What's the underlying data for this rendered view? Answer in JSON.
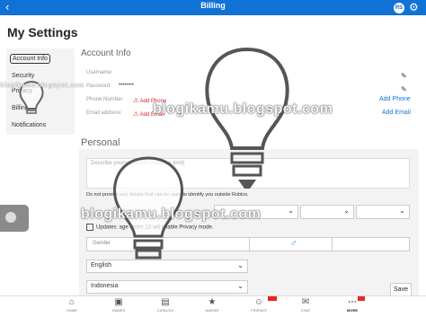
{
  "topbar": {
    "title": "Billing",
    "back_icon": "back-arrow-icon",
    "robux_label": "RS",
    "settings_icon": "gear-icon"
  },
  "page_title": "My Settings",
  "sidebar": {
    "items": [
      {
        "label": "Account Info"
      },
      {
        "label": "Security"
      },
      {
        "label": "Privacy"
      },
      {
        "label": "Billing"
      },
      {
        "label": "Notifications"
      }
    ]
  },
  "account": {
    "section_title": "Account Info",
    "username_label": "Username:",
    "password_label": "Password:",
    "password_value": "••••••••",
    "phone_label": "Phone Number:",
    "phone_add": "Add Phone",
    "email_label": "Email address:",
    "email_add": "Add Email",
    "add_phone_link": "Add Phone",
    "add_email_link": "Add Email"
  },
  "personal": {
    "section_title": "Personal",
    "description_placeholder": "Describe yourself (1000 character limit)",
    "privacy_note": "Do not provide any details that can be used to identify you outside Roblox.",
    "updates_text": "Updates: age under 13 will enable Privacy mode.",
    "gender_label": "Gender",
    "language_value": "English",
    "country_value": "Indonesia",
    "save_label": "Save"
  },
  "watermarks": {
    "top": "blogikamu.blogspot.com",
    "bottom": "blogikamu.blogspot.com",
    "side": "blogikamu.blogspot.com"
  },
  "bottom_nav": [
    {
      "label": "HOME",
      "icon": "home-icon"
    },
    {
      "label": "GAMES",
      "icon": "gamepad-icon"
    },
    {
      "label": "CATALOG",
      "icon": "cart-icon"
    },
    {
      "label": "AVATAR",
      "icon": "avatar-icon"
    },
    {
      "label": "FRIENDS",
      "icon": "friends-icon"
    },
    {
      "label": "CHAT",
      "icon": "chat-icon"
    },
    {
      "label": "MORE",
      "icon": "more-icon"
    }
  ],
  "colors": {
    "accent": "#1172d6",
    "warning": "#dd2222"
  }
}
